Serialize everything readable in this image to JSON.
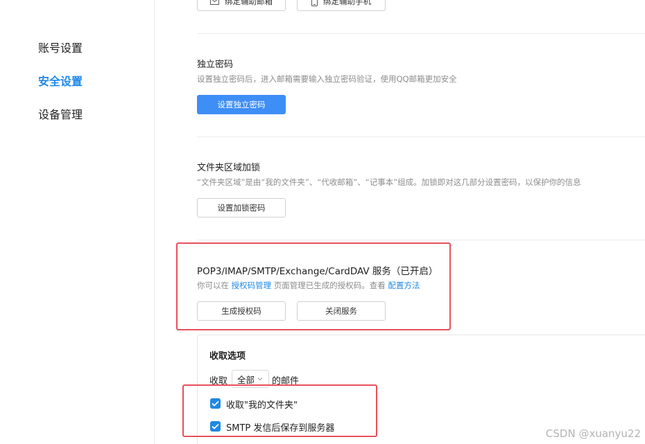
{
  "sidebar": {
    "items": [
      {
        "label": "账号设置",
        "active": false
      },
      {
        "label": "安全设置",
        "active": true
      },
      {
        "label": "设备管理",
        "active": false
      }
    ]
  },
  "top_buttons": {
    "bind_email": "绑定辅助邮箱",
    "bind_phone": "绑定辅助手机"
  },
  "independent_password": {
    "title": "独立密码",
    "desc": "设置独立密码后，进入邮箱需要输入独立密码验证，使用QQ邮箱更加安全",
    "button": "设置独立密码"
  },
  "folder_lock": {
    "title": "文件夹区域加锁",
    "desc": "“文件夹区域”是由“我的文件夹”、“代收邮箱”、“记事本”组成。加锁即对这几部分设置密码，以保护你的信息",
    "button": "设置加锁密码"
  },
  "service": {
    "title": "POP3/IMAP/SMTP/Exchange/CardDAV 服务（已开启）",
    "desc_prefix": "你可以在 ",
    "desc_link1": "授权码管理",
    "desc_middle": " 页面管理已生成的授权码。查看 ",
    "desc_link2": "配置方法",
    "generate_button": "生成授权码",
    "close_button": "关闭服务"
  },
  "receive_options": {
    "title": "收取选项",
    "receive_prefix": "收取",
    "scope_value": "全部",
    "receive_suffix": "的邮件",
    "checkbox1": "收取\"我的文件夹\"",
    "checkbox2": "SMTP 发信后保存到服务器"
  },
  "colors": {
    "accent": "#1e88e5",
    "primary_button": "#3e8ef7",
    "highlight": "#e8505b"
  },
  "watermark": "CSDN @xuanyu22"
}
